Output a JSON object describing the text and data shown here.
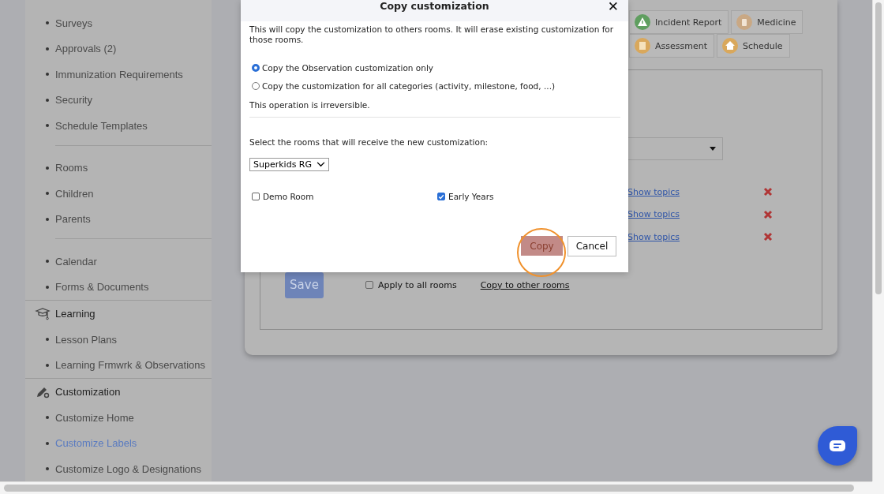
{
  "sidebar": {
    "sections": [
      {
        "kind": "group",
        "items": [
          {
            "label": "Surveys",
            "selected": false
          },
          {
            "label": "Approvals (2)",
            "selected": false
          },
          {
            "label": "Immunization Requirements",
            "selected": false
          },
          {
            "label": "Security",
            "selected": false
          },
          {
            "label": "Schedule Templates",
            "selected": false
          }
        ]
      },
      {
        "kind": "group",
        "items": [
          {
            "label": "Rooms",
            "selected": false
          },
          {
            "label": "Children",
            "selected": false
          },
          {
            "label": "Parents",
            "selected": false
          }
        ]
      },
      {
        "kind": "group",
        "items": [
          {
            "label": "Calendar",
            "selected": false
          },
          {
            "label": "Forms & Documents",
            "selected": false
          }
        ]
      },
      {
        "kind": "titled",
        "header": "Learning",
        "items": [
          {
            "label": "Lesson Plans",
            "selected": false
          },
          {
            "label": "Learning Frmwrk & Observations",
            "selected": false
          }
        ]
      },
      {
        "kind": "titled",
        "header": "Customization",
        "items": [
          {
            "label": "Customize Home",
            "selected": false
          },
          {
            "label": "Customize Labels",
            "selected": true
          },
          {
            "label": "Customize Logo & Designations",
            "selected": false
          }
        ]
      }
    ]
  },
  "category_tabs": [
    [
      {
        "label": "Incident Report",
        "color": "#5f9e5f"
      },
      {
        "label": "Medicine",
        "color": "#c9a884"
      }
    ],
    [
      {
        "label": "Assessment",
        "color": "#d9a85c"
      },
      {
        "label": "Schedule",
        "color": "#d9a85c"
      }
    ]
  ],
  "topic_rows": [
    {
      "link": "Show topics"
    },
    {
      "link": "Show topics"
    },
    {
      "link": "Show topics"
    }
  ],
  "footer": {
    "save_button": "Save",
    "apply_all": {
      "label": "Apply to all rooms",
      "checked": false
    },
    "copy_link": "Copy to other rooms"
  },
  "dialog": {
    "title": "Copy customization",
    "close": "✕",
    "intro": "This will copy the customization to others rooms. It will erase existing customization for those rooms.",
    "options": [
      {
        "label": "Copy the Observation customization only",
        "selected": true
      },
      {
        "label": "Copy the customization for all categories (activity, milestone, food, ...)",
        "selected": false
      }
    ],
    "note": "This operation is irreversible.",
    "rooms_prompt": "Select the rooms that will receive the new customization:",
    "room_select": "Superkids RG",
    "rooms": [
      {
        "label": "Demo Room",
        "checked": false
      },
      {
        "label": "Early Years",
        "checked": true
      }
    ],
    "buttons": {
      "copy": "Copy",
      "cancel": "Cancel"
    }
  }
}
